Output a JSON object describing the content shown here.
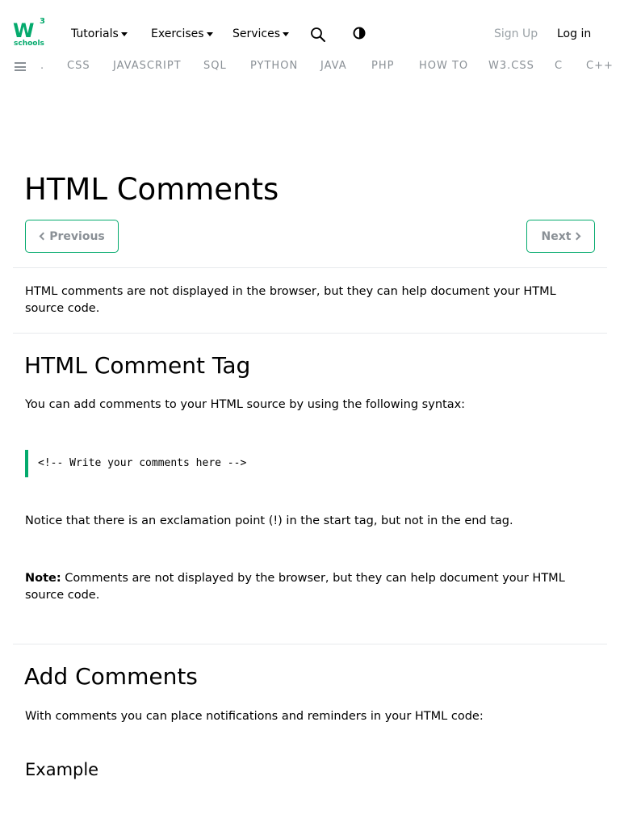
{
  "brand": {
    "mark": "W",
    "superscript": "3",
    "sub": "schools",
    "color": "#04AA6D"
  },
  "topnav": {
    "tutorials": "Tutorials",
    "exercises": "Exercises",
    "services": "Services",
    "sign_up": "Sign Up",
    "log_in": "Log in",
    "icons": [
      "search-icon",
      "contrast-icon"
    ]
  },
  "subnav": {
    "items": [
      ".",
      "CSS",
      "JAVASCRIPT",
      "SQL",
      "PYTHON",
      "JAVA",
      "PHP",
      "HOW TO",
      "W3.CSS",
      "C",
      "C++"
    ]
  },
  "page": {
    "title": "HTML Comments",
    "prev": "Previous",
    "next": "Next",
    "intro": "HTML comments are not displayed in the browser, but they can help document your HTML source code."
  },
  "section_tag": {
    "heading": "HTML Comment Tag",
    "text": "You can add comments to your HTML source by using the following syntax:",
    "code": "<!-- Write your comments here -->",
    "notice": "Notice that there is an exclamation point (!) in the start tag, but not in the end tag.",
    "note_label": "Note:",
    "note_text": "Comments are not displayed by the browser, but they can help document your HTML source code."
  },
  "section_add": {
    "heading": "Add Comments",
    "text": "With comments you can place notifications and reminders in your HTML code:",
    "example_heading": "Example"
  }
}
